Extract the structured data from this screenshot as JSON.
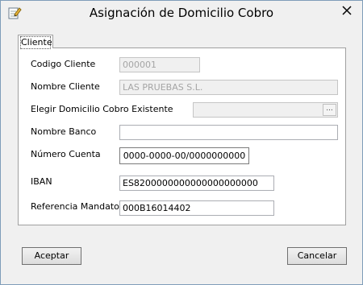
{
  "window": {
    "title": "Asignación de Domicilio Cobro",
    "icon": "edit-icon",
    "close": "close-icon"
  },
  "tabs": [
    {
      "label": "Cliente",
      "selected": true
    }
  ],
  "form": {
    "codigo_cliente": {
      "label": "Codigo Cliente",
      "value": "000001"
    },
    "nombre_cliente": {
      "label": "Nombre Cliente",
      "value": "LAS PRUEBAS S.L."
    },
    "elegir_domicilio": {
      "label": "Elegir Domicilio Cobro Existente",
      "value": "",
      "button_label": "..."
    },
    "nombre_banco": {
      "label": "Nombre Banco",
      "value": ""
    },
    "numero_cuenta": {
      "label": "Número Cuenta",
      "value": "0000-0000-00/0000000000"
    },
    "iban": {
      "label": "IBAN",
      "value": "ES8200000000000000000000"
    },
    "referencia_mandato": {
      "label": "Referencia Mandato",
      "value": "000B16014402"
    }
  },
  "buttons": {
    "accept": "Aceptar",
    "cancel": "Cancelar"
  }
}
